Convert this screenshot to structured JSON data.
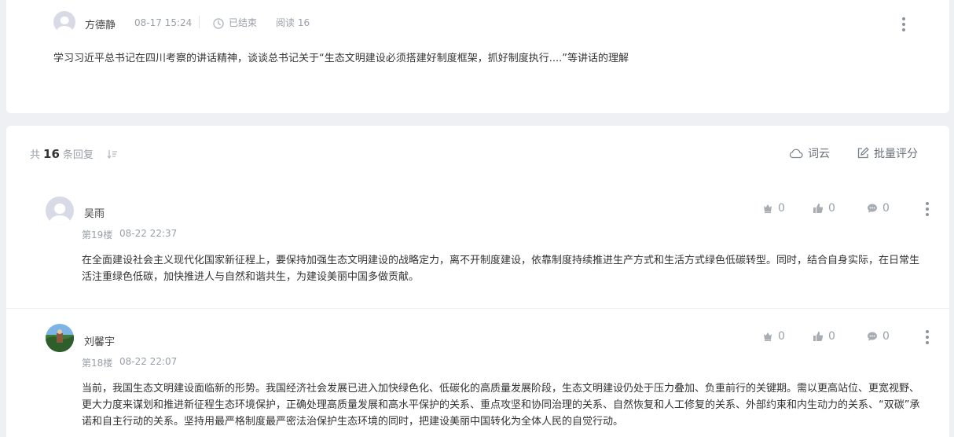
{
  "topic": {
    "author": "方德静",
    "time": "08-17 15:24",
    "status": "已结束",
    "views": "阅读 16",
    "content": "学习习近平总书记在四川考察的讲话精神，谈谈总书记关于“生态文明建设必须搭建好制度框架，抓好制度执行....”等讲话的理解"
  },
  "replies_header": {
    "prefix": "共",
    "count": "16",
    "suffix": "条回复",
    "wordcloud_label": "词云",
    "batch_score_label": "批量评分"
  },
  "replies": [
    {
      "author": "吴雨",
      "floor": "第19楼",
      "time": "08-22 22:37",
      "award_count": "0",
      "like_count": "0",
      "comment_count": "0",
      "content": "在全面建设社会主义现代化国家新征程上，要保持加强生态文明建设的战略定力，离不开制度建设，依靠制度持续推进生产方式和生活方式绿色低碳转型。同时，结合自身实际，在日常生活注重绿色低碳，加快推进人与自然和谐共生，为建设美丽中国多做贡献。"
    },
    {
      "author": "刘馨宇",
      "floor": "第18楼",
      "time": "08-22 22:07",
      "award_count": "0",
      "like_count": "0",
      "comment_count": "0",
      "content": "当前，我国生态文明建设面临新的形势。我国经济社会发展已进入加快绿色化、低碳化的高质量发展阶段，生态文明建设仍处于压力叠加、负重前行的关键期。需以更高站位、更宽视野、更大力度来谋划和推进新征程生态环境保护，正确处理高质量发展和高水平保护的关系、重点攻坚和协同治理的关系、自然恢复和人工修复的关系、外部约束和内生动力的关系、“双碳”承诺和自主行动的关系。坚持用最严格制度最严密法治保护生态环境的同时，把建设美丽中国转化为全体人民的自觉行动。"
    }
  ]
}
